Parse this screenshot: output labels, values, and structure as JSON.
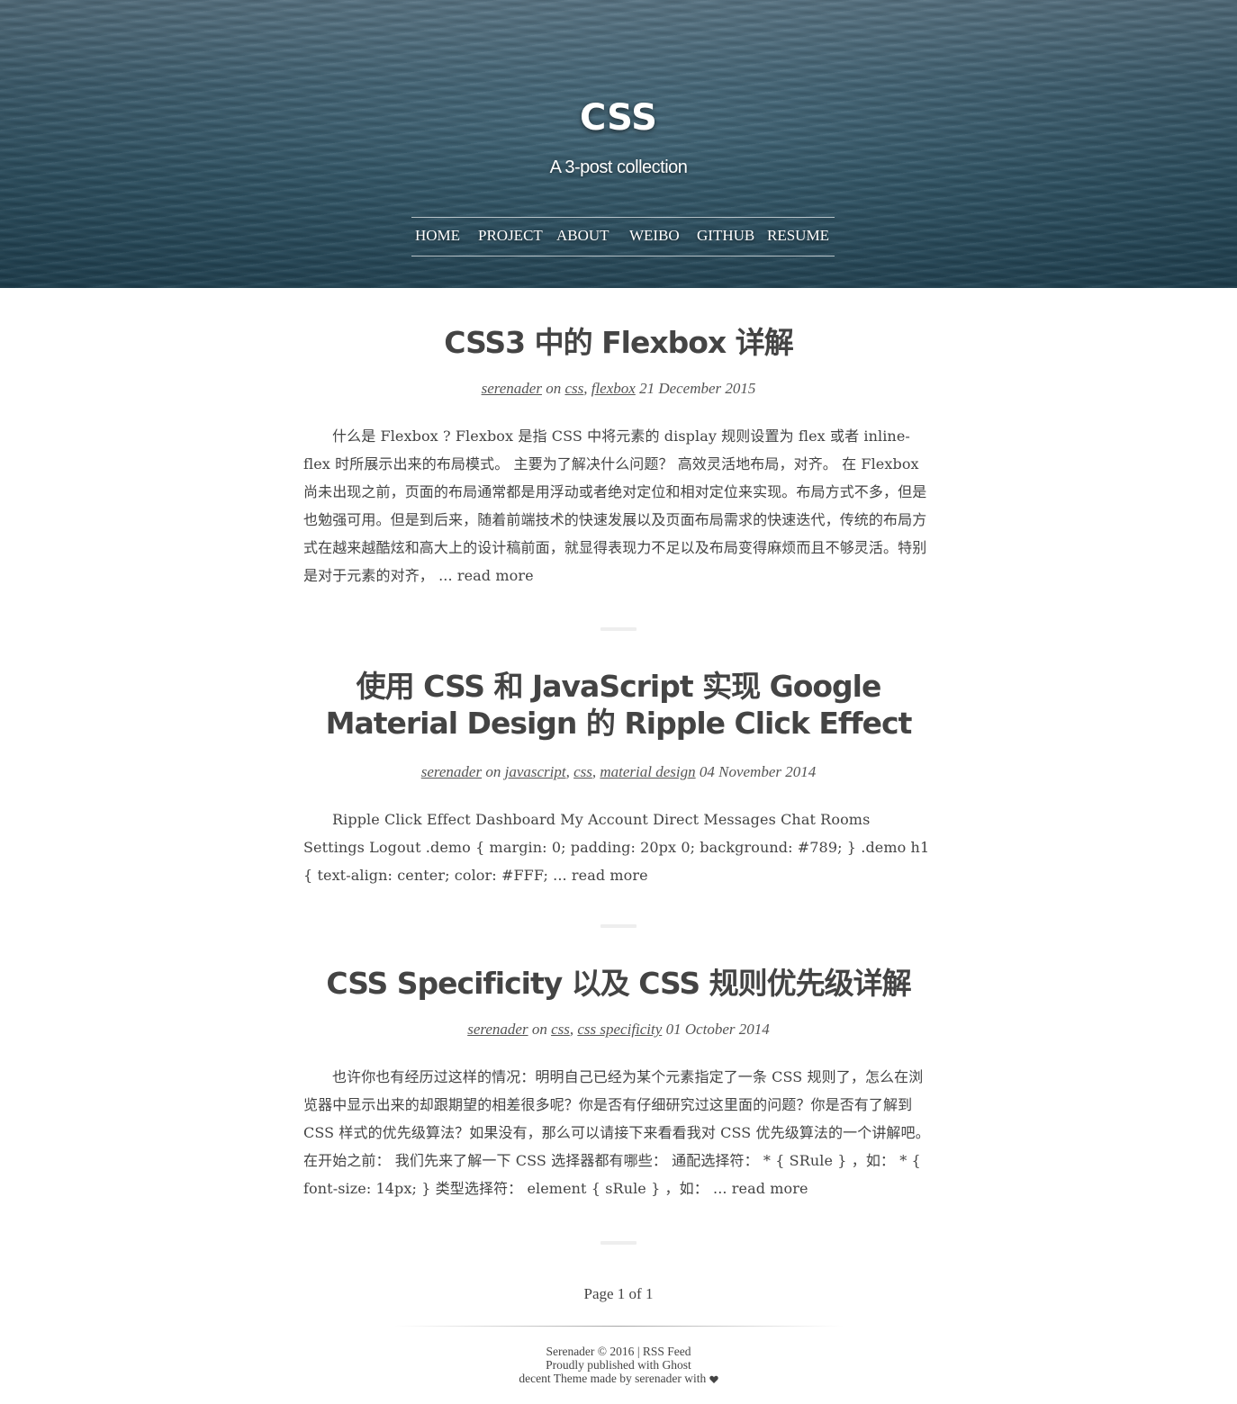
{
  "header": {
    "title": "CSS",
    "subtitle": "A 3-post collection",
    "nav": [
      {
        "label": "HOME"
      },
      {
        "label": "PROJECT"
      },
      {
        "label": "ABOUT"
      },
      {
        "label": "WEIBO"
      },
      {
        "label": "GITHUB"
      },
      {
        "label": "RESUME"
      }
    ]
  },
  "posts": [
    {
      "title": "CSS3 中的 Flexbox 详解",
      "author": "serenader",
      "on": "on",
      "tags": [
        "css",
        "flexbox"
      ],
      "date": "21 December 2015",
      "excerpt": "什么是 Flexbox ? Flexbox 是指 CSS 中将元素的 display 规则设置为 flex 或者 inline-flex 时所展示出来的布局模式。 主要为了解决什么问题？ 高效灵活地布局，对齐。 在 Flexbox 尚未出现之前，页面的布局通常都是用浮动或者绝对定位和相对定位来实现。布局方式不多，但是也勉强可用。但是到后来，随着前端技术的快速发展以及页面布局需求的快速迭代，传统的布局方式在越来越酷炫和高大上的设计稿前面，就显得表现力不足以及布局变得麻烦而且不够灵活。特别是对于元素的对齐，",
      "read_more": "... read more"
    },
    {
      "title": "使用 CSS 和 JavaScript 实现 Google Material Design 的 Ripple Click Effect",
      "author": "serenader",
      "on": "on",
      "tags": [
        "javascript",
        "css",
        "material design"
      ],
      "date": "04 November 2014",
      "excerpt": "Ripple Click Effect Dashboard My Account Direct Messages Chat Rooms Settings Logout .demo { margin: 0; padding: 20px 0; background: #789; } .demo h1 { text-align: center; color: #FFF;",
      "read_more": "... read more"
    },
    {
      "title": "CSS Specificity 以及 CSS 规则优先级详解",
      "author": "serenader",
      "on": "on",
      "tags": [
        "css",
        "css specificity"
      ],
      "date": "01 October 2014",
      "excerpt": "也许你也有经历过这样的情况：明明自己已经为某个元素指定了一条 CSS 规则了，怎么在浏览器中显示出来的却跟期望的相差很多呢？你是否有仔细研究过这里面的问题？你是否有了解到 CSS 样式的优先级算法？如果没有，那么可以请接下来看看我对 CSS 优先级算法的一个讲解吧。 在开始之前： 我们先来了解一下 CSS 选择器都有哪些： 通配选择符： * { SRule } ，如： * { font-size: 14px; } 类型选择符： element { sRule } ，如：",
      "read_more": "... read more"
    }
  ],
  "pagination": "Page 1 of 1",
  "footer": {
    "copyright": "Serenader © 2016",
    "separator": "|",
    "rss": "RSS Feed",
    "published": "Proudly published with Ghost",
    "theme": "decent Theme made by serenader with"
  }
}
